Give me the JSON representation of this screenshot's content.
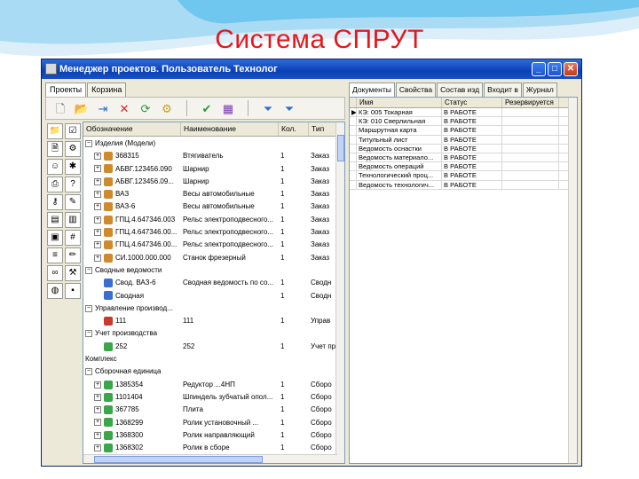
{
  "slide": {
    "title": "Система СПРУТ"
  },
  "window": {
    "title": "Менеджер проектов. Пользователь Технолог"
  },
  "left": {
    "tabs": [
      "Проекты",
      "Корзина"
    ],
    "columns": [
      "Обозначение",
      "Наименование",
      "Кол.",
      "Тип"
    ],
    "rows": [
      {
        "exp": "−",
        "indent": 0,
        "c0": "Изделия (Модели)",
        "c1": "",
        "c2": "",
        "c3": ""
      },
      {
        "exp": "+",
        "indent": 1,
        "icon": "doc",
        "c0": "368315",
        "c1": "Втягиватель",
        "c2": "1",
        "c3": "Заказ"
      },
      {
        "exp": "+",
        "indent": 1,
        "icon": "doc",
        "c0": "АБВГ.123456.090",
        "c1": "Шарнир",
        "c2": "1",
        "c3": "Заказ"
      },
      {
        "exp": "+",
        "indent": 1,
        "icon": "doc",
        "c0": "АБВГ.123456.09...",
        "c1": "Шарнир",
        "c2": "1",
        "c3": "Заказ"
      },
      {
        "exp": "+",
        "indent": 1,
        "icon": "doc",
        "c0": "ВАЗ",
        "c1": "Весы автомобильные",
        "c2": "1",
        "c3": "Заказ"
      },
      {
        "exp": "+",
        "indent": 1,
        "icon": "doc",
        "c0": "ВАЗ-6",
        "c1": "Весы автомобильные",
        "c2": "1",
        "c3": "Заказ"
      },
      {
        "exp": "+",
        "indent": 1,
        "icon": "doc",
        "c0": "ГПЦ.4.647346.003",
        "c1": "Рельс электроподвесного...",
        "c2": "1",
        "c3": "Заказ"
      },
      {
        "exp": "+",
        "indent": 1,
        "icon": "doc",
        "c0": "ГПЦ.4.647346.00...",
        "c1": "Рельс электроподвесного...",
        "c2": "1",
        "c3": "Заказ"
      },
      {
        "exp": "+",
        "indent": 1,
        "icon": "doc",
        "c0": "ГПЦ.4.647346.00...",
        "c1": "Рельс электроподвесного...",
        "c2": "1",
        "c3": "Заказ"
      },
      {
        "exp": "+",
        "indent": 1,
        "icon": "doc",
        "c0": "СИ.1000.000.000",
        "c1": "Станок фрезерный",
        "c2": "1",
        "c3": "Заказ"
      },
      {
        "exp": "−",
        "indent": 0,
        "c0": "Сводные ведомости",
        "c1": "",
        "c2": "",
        "c3": ""
      },
      {
        "exp": "",
        "indent": 1,
        "icon": "blue",
        "c0": "Свод. ВАЗ-6",
        "c1": "Сводная ведомость по со...",
        "c2": "1",
        "c3": "Сводн"
      },
      {
        "exp": "",
        "indent": 1,
        "icon": "blue",
        "c0": "Сводная",
        "c1": "",
        "c2": "1",
        "c3": "Сводн"
      },
      {
        "exp": "−",
        "indent": 0,
        "c0": "Управление производ...",
        "c1": "",
        "c2": "",
        "c3": ""
      },
      {
        "exp": "",
        "indent": 1,
        "icon": "red",
        "c0": "111",
        "c1": "111",
        "c2": "1",
        "c3": "Управ"
      },
      {
        "exp": "−",
        "indent": 0,
        "c0": "Учет производства",
        "c1": "",
        "c2": "",
        "c3": ""
      },
      {
        "exp": "",
        "indent": 1,
        "icon": "green",
        "c0": "252",
        "c1": "252",
        "c2": "1",
        "c3": "Учет пр"
      },
      {
        "exp": "",
        "indent": 0,
        "c0": "Комплекс",
        "c1": "",
        "c2": "",
        "c3": ""
      },
      {
        "exp": "−",
        "indent": 0,
        "c0": "Сборочная единица",
        "c1": "",
        "c2": "",
        "c3": ""
      },
      {
        "exp": "+",
        "indent": 1,
        "icon": "green",
        "c0": "1385354",
        "c1": "Редуктор ...4НП",
        "c2": "1",
        "c3": "Сборо"
      },
      {
        "exp": "+",
        "indent": 1,
        "icon": "green",
        "c0": "1101404",
        "c1": "Шпиндель зубчатый опол...",
        "c2": "1",
        "c3": "Сборо"
      },
      {
        "exp": "+",
        "indent": 1,
        "icon": "green",
        "c0": "367785",
        "c1": "Плита",
        "c2": "1",
        "c3": "Сборо"
      },
      {
        "exp": "+",
        "indent": 1,
        "icon": "green",
        "c0": "1368299",
        "c1": "Ролик установочный ...",
        "c2": "1",
        "c3": "Сборо"
      },
      {
        "exp": "+",
        "indent": 1,
        "icon": "green",
        "c0": "1368300",
        "c1": "Ролик направляющий",
        "c2": "1",
        "c3": "Сборо"
      },
      {
        "exp": "+",
        "indent": 1,
        "icon": "green",
        "c0": "1368302",
        "c1": "Ролик в сборе",
        "c2": "1",
        "c3": "Сборо"
      }
    ]
  },
  "right": {
    "tabs": [
      "Документы",
      "Свойства",
      "Состав изд",
      "Входит в",
      "Журнал"
    ],
    "columns": [
      "",
      "Имя",
      "Статус",
      "Резервируется"
    ],
    "rows": [
      {
        "mark": "▶",
        "name": "КЭ: 005 Токарная",
        "status": "В РАБОТЕ",
        "res": ""
      },
      {
        "mark": "",
        "name": "КЭ: 010 Сверлильная",
        "status": "В РАБОТЕ",
        "res": ""
      },
      {
        "mark": "",
        "name": "Маршрутная карта",
        "status": "В РАБОТЕ",
        "res": ""
      },
      {
        "mark": "",
        "name": "Титульный лист",
        "status": "В РАБОТЕ",
        "res": ""
      },
      {
        "mark": "",
        "name": "Ведомость оснастки",
        "status": "В РАБОТЕ",
        "res": ""
      },
      {
        "mark": "",
        "name": "Ведомость материало...",
        "status": "В РАБОТЕ",
        "res": ""
      },
      {
        "mark": "",
        "name": "Ведомость операций",
        "status": "В РАБОТЕ",
        "res": ""
      },
      {
        "mark": "",
        "name": "Технологический проц...",
        "status": "В РАБОТЕ",
        "res": ""
      },
      {
        "mark": "",
        "name": "Ведомость технологич...",
        "status": "В РАБОТЕ",
        "res": ""
      }
    ]
  },
  "colors": {
    "title": "#e8161a",
    "titlebar": "#0a3fb8"
  },
  "toolbar_icons": [
    "new-doc-icon",
    "open-folder-icon",
    "export-icon",
    "delete-icon",
    "refresh-icon",
    "properties-icon",
    "checkin-icon",
    "table-icon",
    "filter-icon",
    "filter-edit-icon"
  ],
  "side_icons": [
    "folder-icon",
    "task-icon",
    "doc-icon",
    "assembly-icon",
    "user-icon",
    "gear-icon",
    "print-icon",
    "help-icon",
    "key-icon",
    "tools-icon",
    "chart-icon",
    "book-icon",
    "image-icon",
    "calc-icon",
    "list-icon",
    "pencil-icon",
    "link-icon",
    "settings-icon",
    "globe-icon",
    "lock-icon"
  ]
}
